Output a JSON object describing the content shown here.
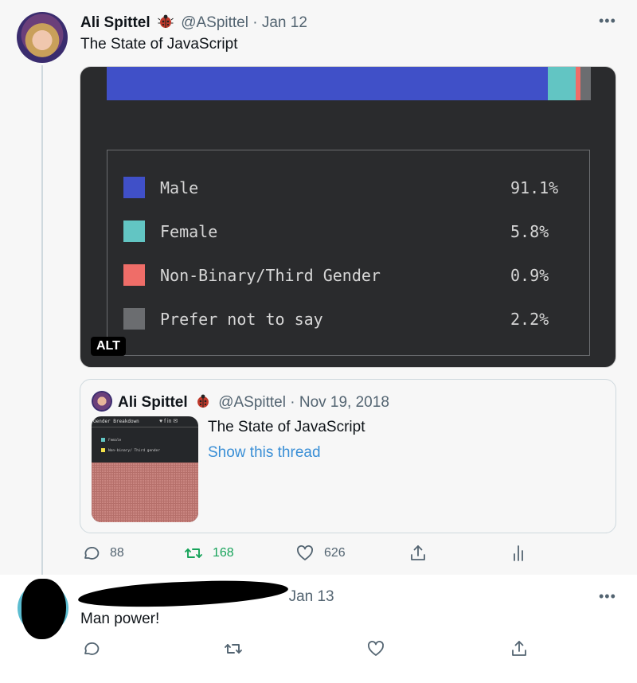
{
  "tweet": {
    "author_name": "Ali Spittel",
    "author_handle": "@ASpittel",
    "separator": "·",
    "date": "Jan 12",
    "text": "The State of JavaScript",
    "more_icon": "more-horizontal-icon",
    "badge_icon": "ladybug-icon",
    "media": {
      "alt_badge": "ALT",
      "legend": [
        {
          "label": "Male",
          "value": "91.1%",
          "color": "#4050c8"
        },
        {
          "label": "Female",
          "value": "5.8%",
          "color": "#62c5c3"
        },
        {
          "label": "Non-Binary/Third Gender",
          "value": "0.9%",
          "color": "#ef6d68"
        },
        {
          "label": "Prefer not to say",
          "value": "2.2%",
          "color": "#6b6d70"
        }
      ]
    },
    "quote": {
      "author_name": "Ali Spittel",
      "author_handle": "@ASpittel",
      "separator": "·",
      "date": "Nov 19, 2018",
      "text": "The State of JavaScript",
      "link": "Show this thread",
      "thumb_title": "Gender Breakdown",
      "thumb_legend": [
        "Female",
        "Non-binary/ Third gender"
      ]
    },
    "actions": {
      "replies": "88",
      "retweets": "168",
      "likes": "626"
    }
  },
  "reply": {
    "date": "Jan 13",
    "text": "Man power!"
  },
  "colors": {
    "retweet_green": "#17a35a",
    "link_blue": "#3a8fd6",
    "media_bg": "#2a2b2d"
  }
}
